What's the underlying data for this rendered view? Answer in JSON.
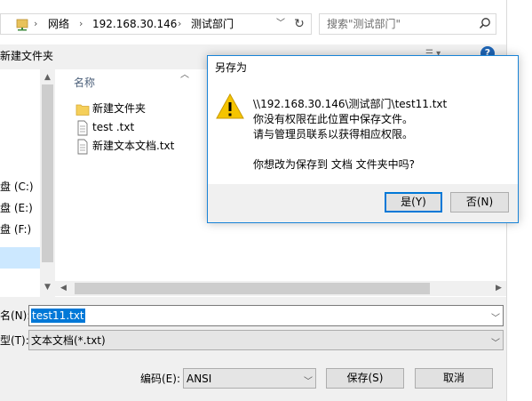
{
  "address": {
    "crumbs": [
      "网络",
      "192.168.30.146",
      "测试部门"
    ],
    "separator": "›"
  },
  "search": {
    "placeholder": "搜索\"测试部门\""
  },
  "toolbar": {
    "new_folder_label": "新建文件夹",
    "help_label": "?"
  },
  "nav": {
    "items": [
      {
        "label": "盘 (C:)"
      },
      {
        "label": "盘 (E:)"
      },
      {
        "label": "盘 (F:)"
      }
    ]
  },
  "files": {
    "column_name": "名称",
    "items": [
      {
        "label": "新建文件夹",
        "icon": "folder-icon"
      },
      {
        "label": "test .txt",
        "icon": "text-file-icon"
      },
      {
        "label": "新建文本文档.txt",
        "icon": "text-file-icon"
      }
    ]
  },
  "form": {
    "filename_label": "名(N):",
    "filename_value": "test11.txt",
    "filetype_label": "型(T):",
    "filetype_value": "文本文档(*.txt)",
    "encoding_label": "编码(E):",
    "encoding_value": "ANSI",
    "save_label": "保存(S)",
    "cancel_label": "取消"
  },
  "dialog": {
    "title": "另存为",
    "line1": "\\\\192.168.30.146\\测试部门\\test11.txt",
    "line2": "你没有权限在此位置中保存文件。",
    "line3": "请与管理员联系以获得相应权限。",
    "line4": "你想改为保存到 文档 文件夹中吗?",
    "yes_label": "是(Y)",
    "no_label": "否(N)"
  },
  "colors": {
    "accent": "#0078d7",
    "warning": "#f5c400",
    "selection": "#cce8ff"
  }
}
